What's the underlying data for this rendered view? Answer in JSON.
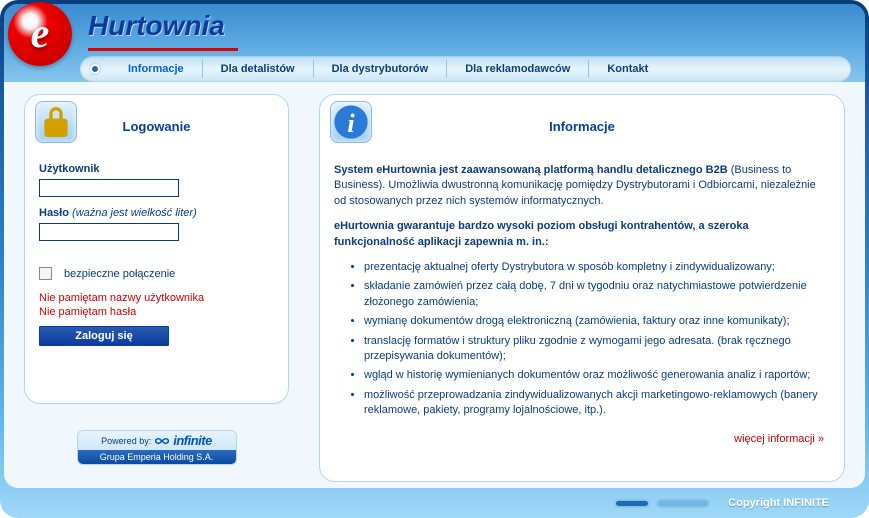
{
  "brand": {
    "logo_letter": "e",
    "title": "Hurtownia"
  },
  "nav": {
    "items": [
      {
        "label": "Informacje",
        "active": true
      },
      {
        "label": "Dla detalistów",
        "active": false
      },
      {
        "label": "Dla dystrybutorów",
        "active": false
      },
      {
        "label": "Dla reklamodawców",
        "active": false
      },
      {
        "label": "Kontakt",
        "active": false
      }
    ]
  },
  "login": {
    "title": "Logowanie",
    "user_label": "Użytkownik",
    "pass_label": "Hasło",
    "pass_hint": "(ważna jest wielkość liter)",
    "secure_label": "bezpieczne połączenie",
    "forgot_user": "Nie pamiętam nazwy użytkownika",
    "forgot_pass": "Nie pamiętam hasła",
    "submit": "Zaloguj się"
  },
  "powered": {
    "prefix": "Powered by:",
    "brand": "infinite",
    "company": "Grupa Emperia Holding S.A."
  },
  "info": {
    "title": "Informacje",
    "p1_bold": "System eHurtownia jest zaawansowaną platformą handlu detalicznego B2B",
    "p1_rest": " (Business to Business). Umożliwia dwustronną komunikację pomiędzy Dystrybutorami i Odbiorcami, niezależnie od stosowanych przez nich systemów informatycznych.",
    "p2": "eHurtownia gwarantuje bardzo wysoki poziom obsługi kontrahentów, a szeroka funkcjonalność aplikacji zapewnia m. in.:",
    "bullets": [
      "prezentację aktualnej oferty Dystrybutora w sposób kompletny i zindywidualizowany;",
      "składanie zamówień przez całą dobę, 7 dni w tygodniu oraz natychmiastowe potwierdzenie złożonego zamówienia;",
      "wymianę dokumentów drogą elektroniczną (zamówienia, faktury oraz inne komunikaty);",
      "translację formatów i struktury pliku zgodnie z wymogami jego adresata. (brak ręcznego przepisywania dokumentów);",
      "wgląd w historię wymienianych dokumentów oraz możliwość generowania analiz i raportów;",
      "możliwość przeprowadzania zindywidualizowanych akcji marketingowo-reklamowych (banery reklamowe, pakiety, programy lojalnościowe, itp.)."
    ],
    "more": "więcej informacji »"
  },
  "footer": {
    "copyright": "Copyright INFINITE"
  }
}
